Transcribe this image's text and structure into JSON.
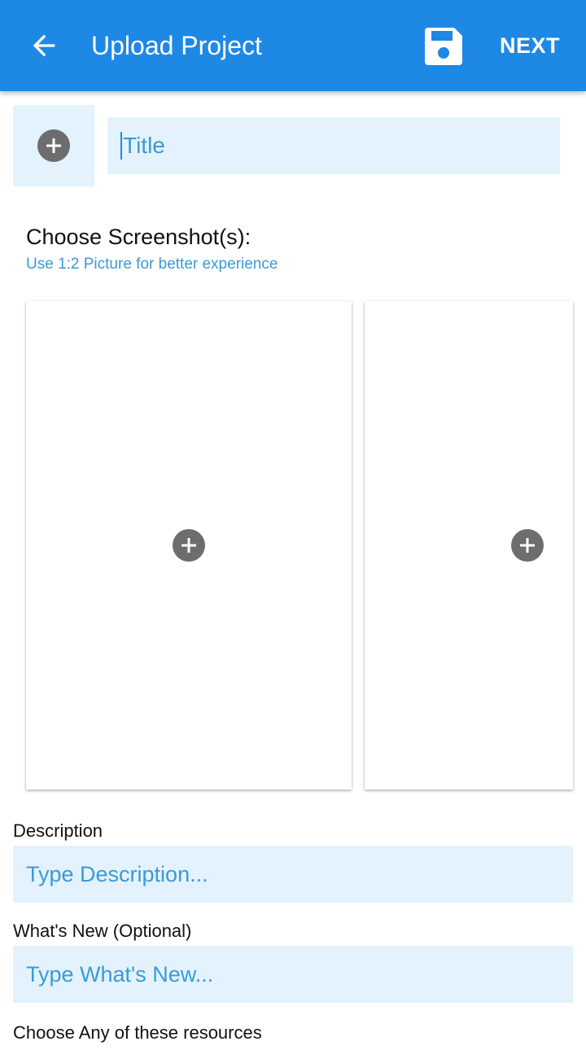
{
  "appbar": {
    "title": "Upload Project",
    "back_icon": "arrow-left-icon",
    "save_icon": "floppy-disk-icon",
    "next_label": "NEXT",
    "color": "#1e88e5"
  },
  "project": {
    "icon_add_icon": "plus-circle-icon",
    "title_placeholder": "Title"
  },
  "screenshots": {
    "label": "Choose Screenshot(s):",
    "hint": "Use 1:2 Picture for better experience",
    "slots_visible": 2
  },
  "description": {
    "label": "Description",
    "placeholder": "Type Description..."
  },
  "whats_new": {
    "label": "What's New (Optional)",
    "placeholder": "Type What's New..."
  },
  "resources": {
    "label": "Choose Any of these resources"
  },
  "colors": {
    "accent": "#1e88e5",
    "field_bg": "#e3f2fd",
    "placeholder": "#3a9ad9",
    "plus_circle": "#6d6d6d"
  }
}
